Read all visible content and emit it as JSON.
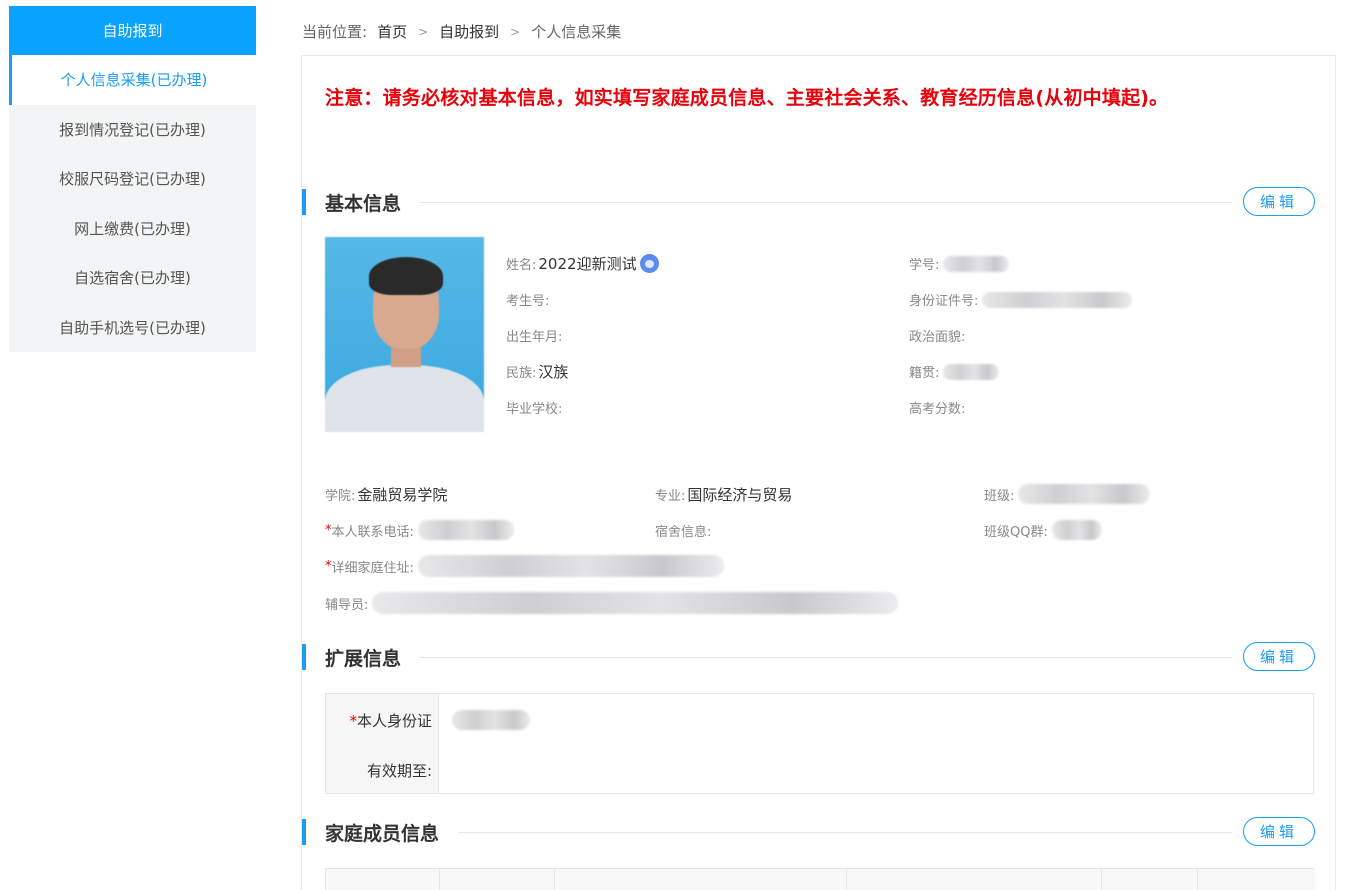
{
  "sidebar": {
    "header": "自助报到",
    "items": [
      {
        "label": "个人信息采集(已办理)",
        "active": true
      },
      {
        "label": "报到情况登记(已办理)",
        "active": false
      },
      {
        "label": "校服尺码登记(已办理)",
        "active": false
      },
      {
        "label": "网上缴费(已办理)",
        "active": false
      },
      {
        "label": "自选宿舍(已办理)",
        "active": false
      },
      {
        "label": "自助手机选号(已办理)",
        "active": false
      }
    ]
  },
  "breadcrumb": {
    "prefix": "当前位置:",
    "items": [
      "首页",
      "自助报到",
      "个人信息采集"
    ],
    "separator": ">"
  },
  "notice": "注意：请务必核对基本信息，如实填写家庭成员信息、主要社会关系、教育经历信息(从初中填起)。",
  "sections": {
    "basic": {
      "title": "基本信息",
      "edit_label": "编辑"
    },
    "extended": {
      "title": "扩展信息",
      "edit_label": "编辑"
    },
    "family": {
      "title": "家庭成员信息",
      "edit_label": "编辑"
    }
  },
  "basic_info": {
    "name_label": "姓名:",
    "name_value": "2022迎新测试",
    "student_id_label": "学号:",
    "exam_no_label": "考生号:",
    "id_card_label": "身份证件号:",
    "birth_label": "出生年月:",
    "political_label": "政治面貌:",
    "ethnicity_label": "民族:",
    "ethnicity_value": "汉族",
    "native_place_label": "籍贯:",
    "school_label": "毕业学校:",
    "score_label": "高考分数:",
    "college_label": "学院:",
    "college_value": "金融贸易学院",
    "major_label": "专业:",
    "major_value": "国际经济与贸易",
    "class_label": "班级:",
    "phone_label": "本人联系电话:",
    "dorm_label": "宿舍信息:",
    "qq_label": "班级QQ群:",
    "address_label": "详细家庭住址:",
    "counselor_label": "辅导员:"
  },
  "extended_info": {
    "id_label": "本人身份证",
    "valid_label": "有效期至:"
  },
  "colors": {
    "accent": "#1a9df2",
    "sidebar_header": "#0aa2ff",
    "notice": "#e8000b",
    "required": "#e8000b"
  },
  "icons": {
    "name_badge": "avatar-badge-icon"
  }
}
